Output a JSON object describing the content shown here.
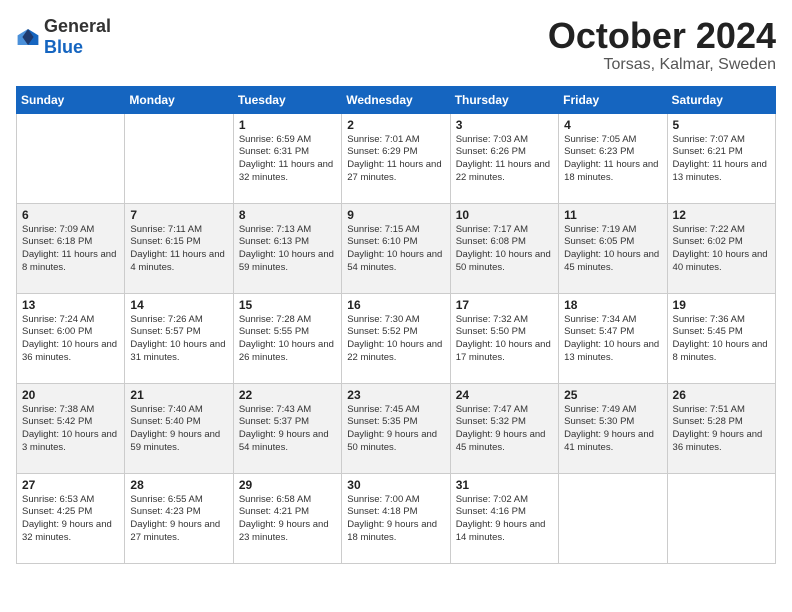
{
  "header": {
    "logo_general": "General",
    "logo_blue": "Blue",
    "month": "October 2024",
    "location": "Torsas, Kalmar, Sweden"
  },
  "weekdays": [
    "Sunday",
    "Monday",
    "Tuesday",
    "Wednesday",
    "Thursday",
    "Friday",
    "Saturday"
  ],
  "weeks": [
    [
      {
        "day": "",
        "info": ""
      },
      {
        "day": "",
        "info": ""
      },
      {
        "day": "1",
        "info": "Sunrise: 6:59 AM\nSunset: 6:31 PM\nDaylight: 11 hours and 32 minutes."
      },
      {
        "day": "2",
        "info": "Sunrise: 7:01 AM\nSunset: 6:29 PM\nDaylight: 11 hours and 27 minutes."
      },
      {
        "day": "3",
        "info": "Sunrise: 7:03 AM\nSunset: 6:26 PM\nDaylight: 11 hours and 22 minutes."
      },
      {
        "day": "4",
        "info": "Sunrise: 7:05 AM\nSunset: 6:23 PM\nDaylight: 11 hours and 18 minutes."
      },
      {
        "day": "5",
        "info": "Sunrise: 7:07 AM\nSunset: 6:21 PM\nDaylight: 11 hours and 13 minutes."
      }
    ],
    [
      {
        "day": "6",
        "info": "Sunrise: 7:09 AM\nSunset: 6:18 PM\nDaylight: 11 hours and 8 minutes."
      },
      {
        "day": "7",
        "info": "Sunrise: 7:11 AM\nSunset: 6:15 PM\nDaylight: 11 hours and 4 minutes."
      },
      {
        "day": "8",
        "info": "Sunrise: 7:13 AM\nSunset: 6:13 PM\nDaylight: 10 hours and 59 minutes."
      },
      {
        "day": "9",
        "info": "Sunrise: 7:15 AM\nSunset: 6:10 PM\nDaylight: 10 hours and 54 minutes."
      },
      {
        "day": "10",
        "info": "Sunrise: 7:17 AM\nSunset: 6:08 PM\nDaylight: 10 hours and 50 minutes."
      },
      {
        "day": "11",
        "info": "Sunrise: 7:19 AM\nSunset: 6:05 PM\nDaylight: 10 hours and 45 minutes."
      },
      {
        "day": "12",
        "info": "Sunrise: 7:22 AM\nSunset: 6:02 PM\nDaylight: 10 hours and 40 minutes."
      }
    ],
    [
      {
        "day": "13",
        "info": "Sunrise: 7:24 AM\nSunset: 6:00 PM\nDaylight: 10 hours and 36 minutes."
      },
      {
        "day": "14",
        "info": "Sunrise: 7:26 AM\nSunset: 5:57 PM\nDaylight: 10 hours and 31 minutes."
      },
      {
        "day": "15",
        "info": "Sunrise: 7:28 AM\nSunset: 5:55 PM\nDaylight: 10 hours and 26 minutes."
      },
      {
        "day": "16",
        "info": "Sunrise: 7:30 AM\nSunset: 5:52 PM\nDaylight: 10 hours and 22 minutes."
      },
      {
        "day": "17",
        "info": "Sunrise: 7:32 AM\nSunset: 5:50 PM\nDaylight: 10 hours and 17 minutes."
      },
      {
        "day": "18",
        "info": "Sunrise: 7:34 AM\nSunset: 5:47 PM\nDaylight: 10 hours and 13 minutes."
      },
      {
        "day": "19",
        "info": "Sunrise: 7:36 AM\nSunset: 5:45 PM\nDaylight: 10 hours and 8 minutes."
      }
    ],
    [
      {
        "day": "20",
        "info": "Sunrise: 7:38 AM\nSunset: 5:42 PM\nDaylight: 10 hours and 3 minutes."
      },
      {
        "day": "21",
        "info": "Sunrise: 7:40 AM\nSunset: 5:40 PM\nDaylight: 9 hours and 59 minutes."
      },
      {
        "day": "22",
        "info": "Sunrise: 7:43 AM\nSunset: 5:37 PM\nDaylight: 9 hours and 54 minutes."
      },
      {
        "day": "23",
        "info": "Sunrise: 7:45 AM\nSunset: 5:35 PM\nDaylight: 9 hours and 50 minutes."
      },
      {
        "day": "24",
        "info": "Sunrise: 7:47 AM\nSunset: 5:32 PM\nDaylight: 9 hours and 45 minutes."
      },
      {
        "day": "25",
        "info": "Sunrise: 7:49 AM\nSunset: 5:30 PM\nDaylight: 9 hours and 41 minutes."
      },
      {
        "day": "26",
        "info": "Sunrise: 7:51 AM\nSunset: 5:28 PM\nDaylight: 9 hours and 36 minutes."
      }
    ],
    [
      {
        "day": "27",
        "info": "Sunrise: 6:53 AM\nSunset: 4:25 PM\nDaylight: 9 hours and 32 minutes."
      },
      {
        "day": "28",
        "info": "Sunrise: 6:55 AM\nSunset: 4:23 PM\nDaylight: 9 hours and 27 minutes."
      },
      {
        "day": "29",
        "info": "Sunrise: 6:58 AM\nSunset: 4:21 PM\nDaylight: 9 hours and 23 minutes."
      },
      {
        "day": "30",
        "info": "Sunrise: 7:00 AM\nSunset: 4:18 PM\nDaylight: 9 hours and 18 minutes."
      },
      {
        "day": "31",
        "info": "Sunrise: 7:02 AM\nSunset: 4:16 PM\nDaylight: 9 hours and 14 minutes."
      },
      {
        "day": "",
        "info": ""
      },
      {
        "day": "",
        "info": ""
      }
    ]
  ]
}
